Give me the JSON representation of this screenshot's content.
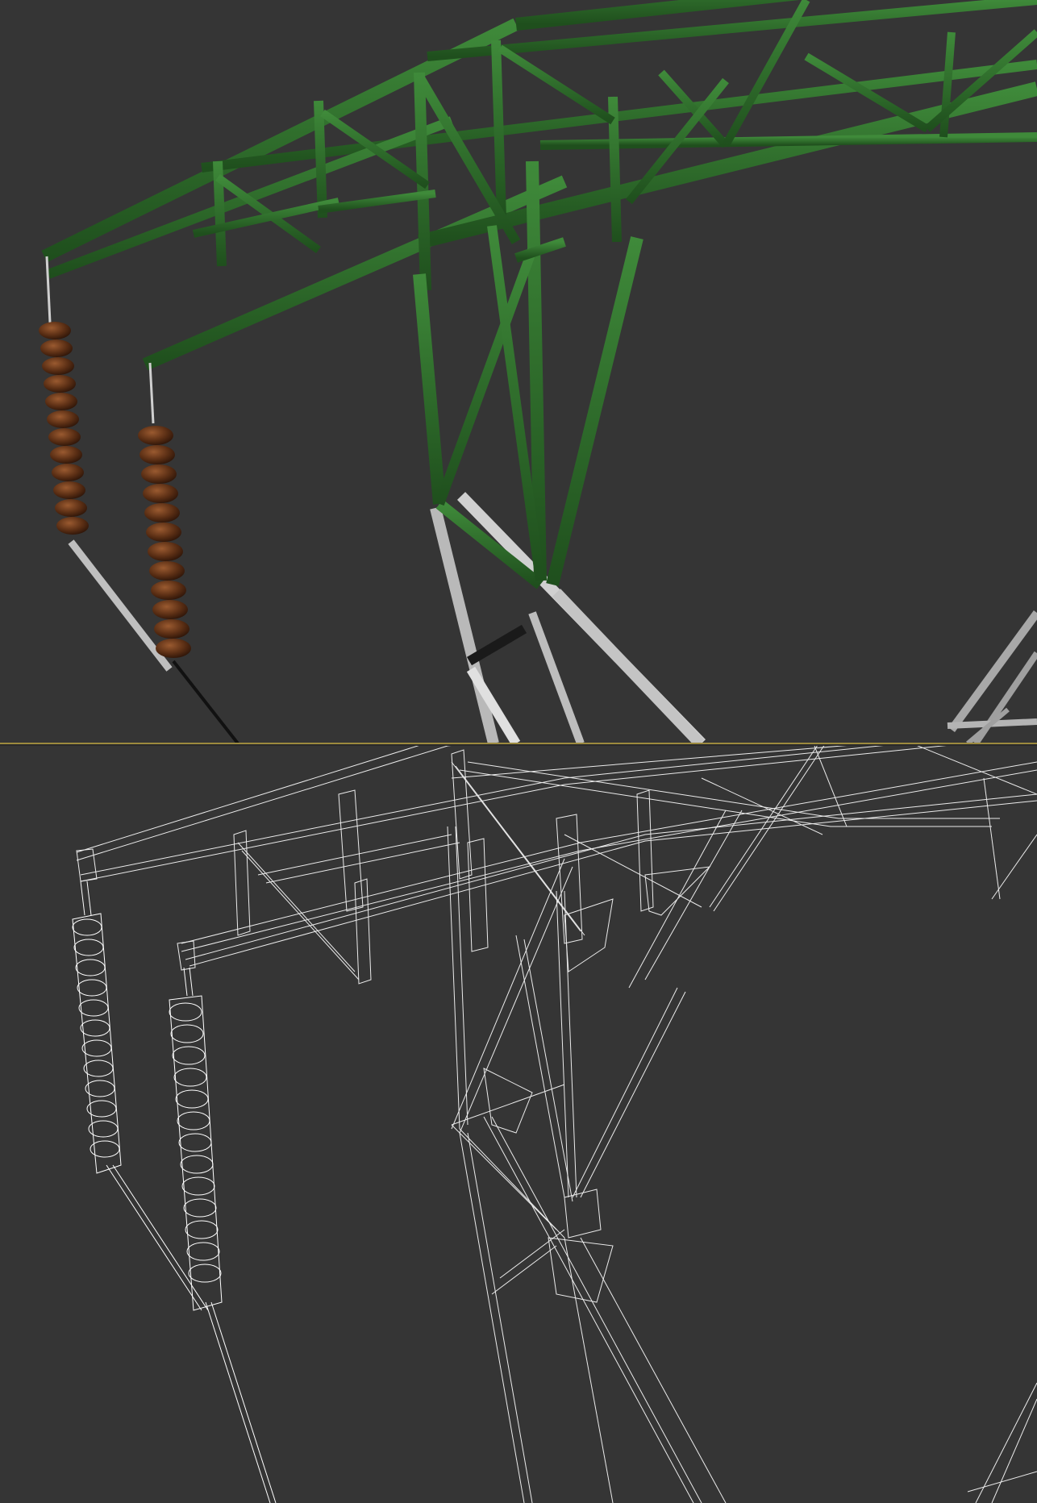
{
  "viewports": [
    {
      "name": "shaded-perspective",
      "render_mode": "shaded"
    },
    {
      "name": "wireframe-perspective",
      "render_mode": "wireframe"
    }
  ],
  "colors": {
    "background": "#353535",
    "steel_green": "#2f6f2c",
    "steel_green_dark": "#1d4a1c",
    "galvanized": "#c8c8c8",
    "insulator": "#5a2e14",
    "wire": "#ffffff",
    "divider": "#9c8a3e"
  }
}
